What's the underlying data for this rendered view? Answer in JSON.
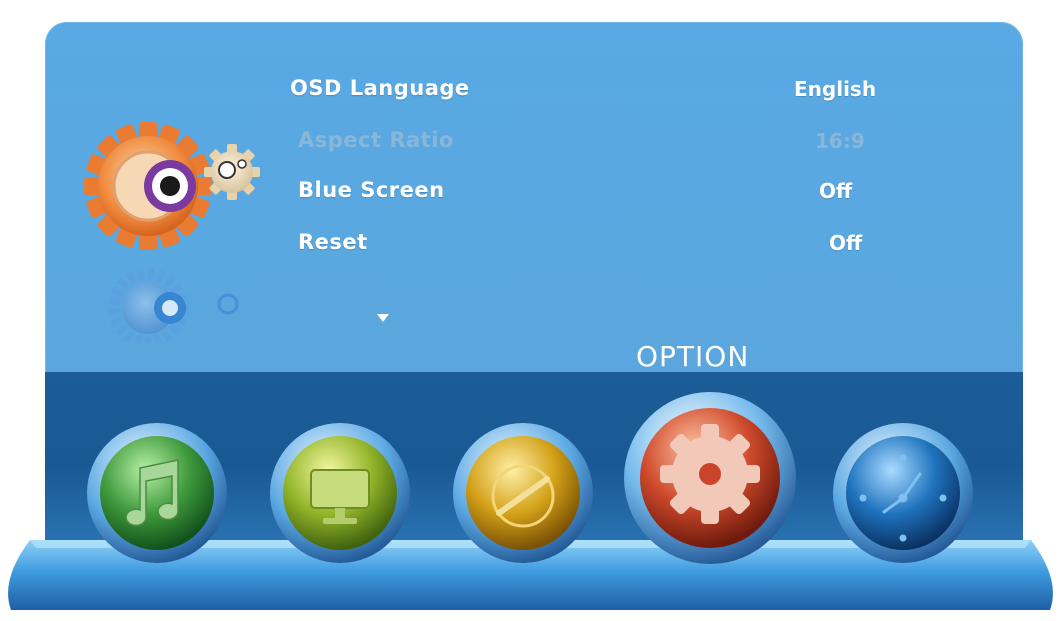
{
  "menu": {
    "items": [
      {
        "label": "OSD Language",
        "value": "English",
        "enabled": true
      },
      {
        "label": "Aspect Ratio",
        "value": "16:9",
        "enabled": false
      },
      {
        "label": "Blue Screen",
        "value": "Off",
        "enabled": true
      },
      {
        "label": "Reset",
        "value": "Off",
        "enabled": true
      }
    ],
    "scroll_indicator": "down-arrow-icon"
  },
  "category": {
    "title": "OPTION",
    "icon": "gear-icon"
  },
  "nav": {
    "buttons": [
      {
        "name": "music",
        "icon": "music-note-icon",
        "color": "#3a9a3a"
      },
      {
        "name": "picture",
        "icon": "monitor-icon",
        "color": "#8cb020"
      },
      {
        "name": "tv",
        "icon": "channel-dial-icon",
        "color": "#c89a10"
      },
      {
        "name": "option",
        "icon": "gear-icon",
        "color": "#c9442a",
        "selected": true
      },
      {
        "name": "time",
        "icon": "clock-icon",
        "color": "#1e6fb8"
      }
    ]
  },
  "colors": {
    "panel": "#5aa8e0",
    "band": "#1d5d97",
    "text": "#ffffff",
    "disabled_text": "#8ab6d8"
  }
}
